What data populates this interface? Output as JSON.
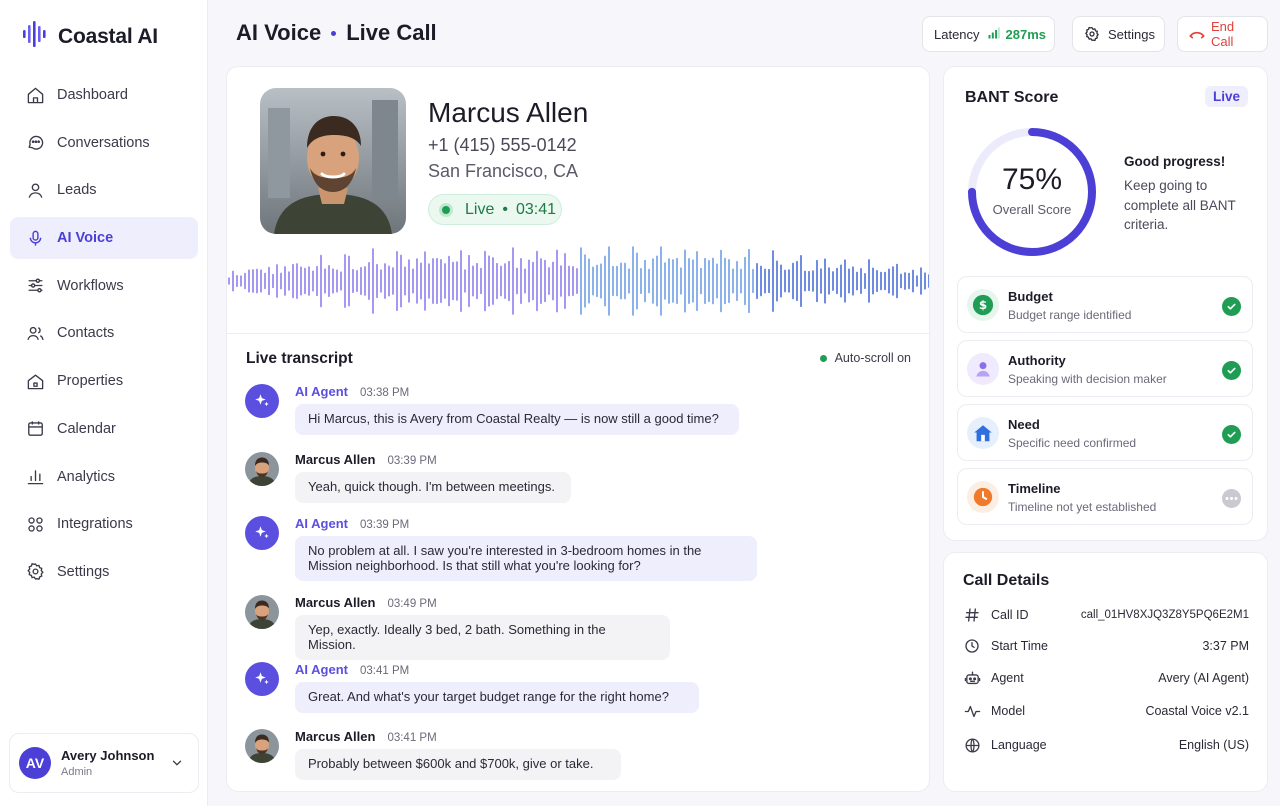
{
  "brand": {
    "name": "Coastal AI"
  },
  "colors": {
    "accent": "#4b3fd6",
    "success": "#1f9d55",
    "danger": "#e0413a"
  },
  "sidebar": {
    "items": [
      {
        "label": "Dashboard",
        "icon": "home-icon",
        "active": false
      },
      {
        "label": "Conversations",
        "icon": "chat-icon",
        "active": false
      },
      {
        "label": "Leads",
        "icon": "user-icon",
        "active": false
      },
      {
        "label": "AI Voice",
        "icon": "microphone-icon",
        "active": true
      },
      {
        "label": "Workflows",
        "icon": "sliders-icon",
        "active": false
      },
      {
        "label": "Contacts",
        "icon": "users-icon",
        "active": false
      },
      {
        "label": "Properties",
        "icon": "house-icon",
        "active": false
      },
      {
        "label": "Calendar",
        "icon": "calendar-icon",
        "active": false
      },
      {
        "label": "Analytics",
        "icon": "bar-chart-icon",
        "active": false
      },
      {
        "label": "Integrations",
        "icon": "grid-icon",
        "active": false
      },
      {
        "label": "Settings",
        "icon": "gear-icon",
        "active": false
      }
    ],
    "user": {
      "initials": "AV",
      "name": "Avery Johnson",
      "role": "Admin"
    }
  },
  "header": {
    "title_left": "AI Voice",
    "title_right": "Live Call",
    "latency_label": "Latency",
    "latency_value": "287ms",
    "settings_label": "Settings",
    "end_call_label": "End Call"
  },
  "caller": {
    "name": "Marcus Allen",
    "phone": "+1 (415) 555-0142",
    "location": "San Francisco, CA",
    "status": "Live",
    "duration": "03:41"
  },
  "transcript": {
    "title": "Live transcript",
    "autoscroll": "Auto-scroll on",
    "messages": [
      {
        "speaker": "AI Agent",
        "role": "ai",
        "time": "03:38 PM",
        "text": "Hi Marcus, this is Avery from Coastal Realty — is now still a good time?"
      },
      {
        "speaker": "Marcus Allen",
        "role": "user",
        "time": "03:39 PM",
        "text": "Yeah, quick though. I'm between meetings."
      },
      {
        "speaker": "AI Agent",
        "role": "ai",
        "time": "03:39 PM",
        "text": "No problem at all. I saw you're interested in 3-bedroom homes in the Mission neighborhood. Is that still what you're looking for?"
      },
      {
        "speaker": "Marcus Allen",
        "role": "user",
        "time": "03:49 PM",
        "text": "Yep, exactly. Ideally 3 bed, 2 bath. Something in the Mission."
      },
      {
        "speaker": "AI Agent",
        "role": "ai",
        "time": "03:41 PM",
        "text": "Great. And what's your target budget range for the right home?"
      },
      {
        "speaker": "Marcus Allen",
        "role": "user",
        "time": "03:41 PM",
        "text": "Probably between $600k and $700k, give or take."
      }
    ]
  },
  "bant": {
    "title": "BANT Score",
    "live_badge": "Live",
    "score_pct": "75%",
    "score_value": 75,
    "score_label": "Overall Score",
    "progress_title": "Good progress!",
    "progress_body": "Keep going to complete all BANT criteria.",
    "criteria": [
      {
        "name": "Budget",
        "desc": "Budget range identified",
        "icon": "dollar-icon",
        "done": true
      },
      {
        "name": "Authority",
        "desc": "Speaking with decision maker",
        "icon": "person-icon",
        "done": true
      },
      {
        "name": "Need",
        "desc": "Specific need confirmed",
        "icon": "house-icon",
        "done": true
      },
      {
        "name": "Timeline",
        "desc": "Timeline not yet established",
        "icon": "clock-icon",
        "done": false
      }
    ]
  },
  "call_details": {
    "title": "Call Details",
    "rows": [
      {
        "label": "Call ID",
        "value": "call_01HV8XJQ3Z8Y5PQ6E2M1",
        "icon": "hash-icon"
      },
      {
        "label": "Start Time",
        "value": "3:37 PM",
        "icon": "clock-icon"
      },
      {
        "label": "Agent",
        "value": "Avery (AI Agent)",
        "icon": "robot-icon"
      },
      {
        "label": "Model",
        "value": "Coastal Voice v2.1",
        "icon": "pulse-icon"
      },
      {
        "label": "Language",
        "value": "English (US)",
        "icon": "globe-icon"
      }
    ]
  }
}
